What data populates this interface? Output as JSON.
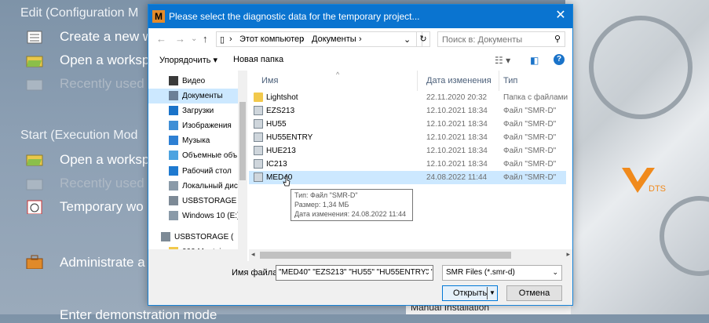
{
  "background": {
    "edit_header": "Edit (Configuration M",
    "start_header": "Start (Execution Mod",
    "items": [
      {
        "label": "Create a new w",
        "dim": false
      },
      {
        "label": "Open a worksp",
        "dim": false
      },
      {
        "label": "Recently used",
        "dim": true
      },
      {
        "label": "Open a worksp",
        "dim": false
      },
      {
        "label": "Recently used",
        "dim": true
      },
      {
        "label": "Temporary wo",
        "dim": false
      },
      {
        "label": "Administrate a",
        "dim": false
      }
    ],
    "bottom_cut_text": "Enter demonstration mode",
    "manual_installation": "Manual Installation",
    "brand_text": "DTS"
  },
  "dialog": {
    "app_icon_letter": "M",
    "title": "Please select the diagnostic data for the temporary project...",
    "close_glyph": "✕",
    "address": {
      "root": "Этот компьютер",
      "folder": "Документы"
    },
    "search_placeholder": "Поиск в: Документы",
    "toolbar": {
      "organize_label": "Упорядочить ▾",
      "new_folder_label": "Новая папка"
    },
    "nav_items": [
      {
        "label": "Видео",
        "icon": "video-icon"
      },
      {
        "label": "Документы",
        "icon": "documents-icon",
        "selected": true
      },
      {
        "label": "Загрузки",
        "icon": "downloads-icon"
      },
      {
        "label": "Изображения",
        "icon": "pictures-icon"
      },
      {
        "label": "Музыка",
        "icon": "music-icon"
      },
      {
        "label": "Объемные объ",
        "icon": "3d-objects-icon"
      },
      {
        "label": "Рабочий стол",
        "icon": "desktop-icon"
      },
      {
        "label": "Локальный дис",
        "icon": "local-disk-icon"
      },
      {
        "label": "USBSTORAGE (D",
        "icon": "usb-drive-icon"
      },
      {
        "label": "Windows 10 (E:)",
        "icon": "drive-icon"
      },
      {
        "label": "USBSTORAGE (D:)",
        "icon": "usb-drive-icon"
      },
      {
        "label": "000 Montaj",
        "icon": "folder-icon"
      }
    ],
    "columns": {
      "name": "Имя",
      "date": "Дата изменения",
      "type": "Тип"
    },
    "files": [
      {
        "name": "Lightshot",
        "date": "22.11.2020 20:32",
        "type": "Папка с файлами",
        "kind": "folder"
      },
      {
        "name": "EZS213",
        "date": "12.10.2021 18:34",
        "type": "Файл \"SMR-D\"",
        "kind": "smr"
      },
      {
        "name": "HU55",
        "date": "12.10.2021 18:34",
        "type": "Файл \"SMR-D\"",
        "kind": "smr"
      },
      {
        "name": "HU55ENTRY",
        "date": "12.10.2021 18:34",
        "type": "Файл \"SMR-D\"",
        "kind": "smr"
      },
      {
        "name": "HUE213",
        "date": "12.10.2021 18:34",
        "type": "Файл \"SMR-D\"",
        "kind": "smr"
      },
      {
        "name": "IC213",
        "date": "12.10.2021 18:34",
        "type": "Файл \"SMR-D\"",
        "kind": "smr"
      },
      {
        "name": "MED40",
        "date": "24.08.2022 11:44",
        "type": "Файл \"SMR-D\"",
        "kind": "smr",
        "selected": true
      }
    ],
    "tooltip": {
      "type_line": "Тип: Файл \"SMR-D\"",
      "size_line": "Размер: 1,34 МБ",
      "date_line": "Дата изменения: 24.08.2022 11:44"
    },
    "filename_label": "Имя файла:",
    "filename_value": "\"MED40\" \"EZS213\" \"HU55\" \"HU55ENTRY\" \"",
    "filetype_value": "SMR Files (*.smr-d)",
    "open_label": "Открыть",
    "cancel_label": "Отмена"
  }
}
